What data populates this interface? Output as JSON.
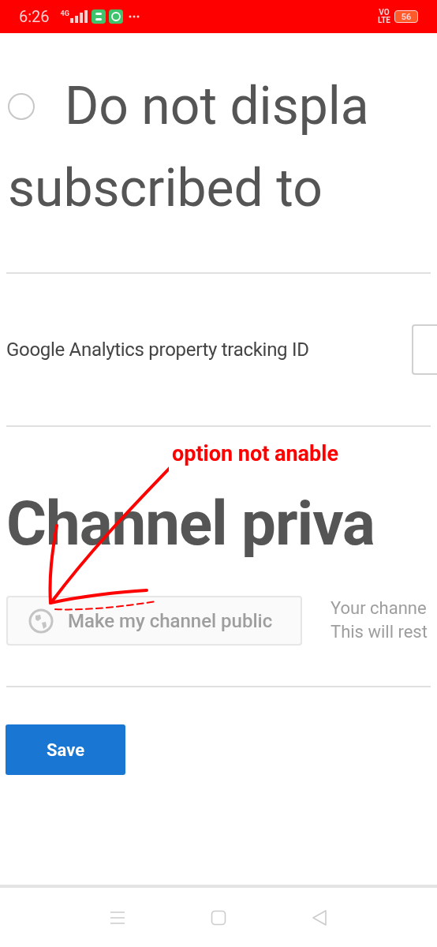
{
  "status_bar": {
    "time": "6:26",
    "network": "4G",
    "volte": "VO",
    "lte": "LTE",
    "battery": "56"
  },
  "radio_option": {
    "label_line_1": "Do not displa",
    "label_line_2": "subscribed to",
    "selected": false
  },
  "analytics": {
    "label": "Google Analytics property tracking ID"
  },
  "annotation": "option not anable",
  "privacy": {
    "heading": "Channel priva",
    "button": {
      "label": "Make my channel public",
      "disabled": true
    },
    "description_line_1": "Your channe",
    "description_line_2": "This will rest"
  },
  "save_button": "Save"
}
